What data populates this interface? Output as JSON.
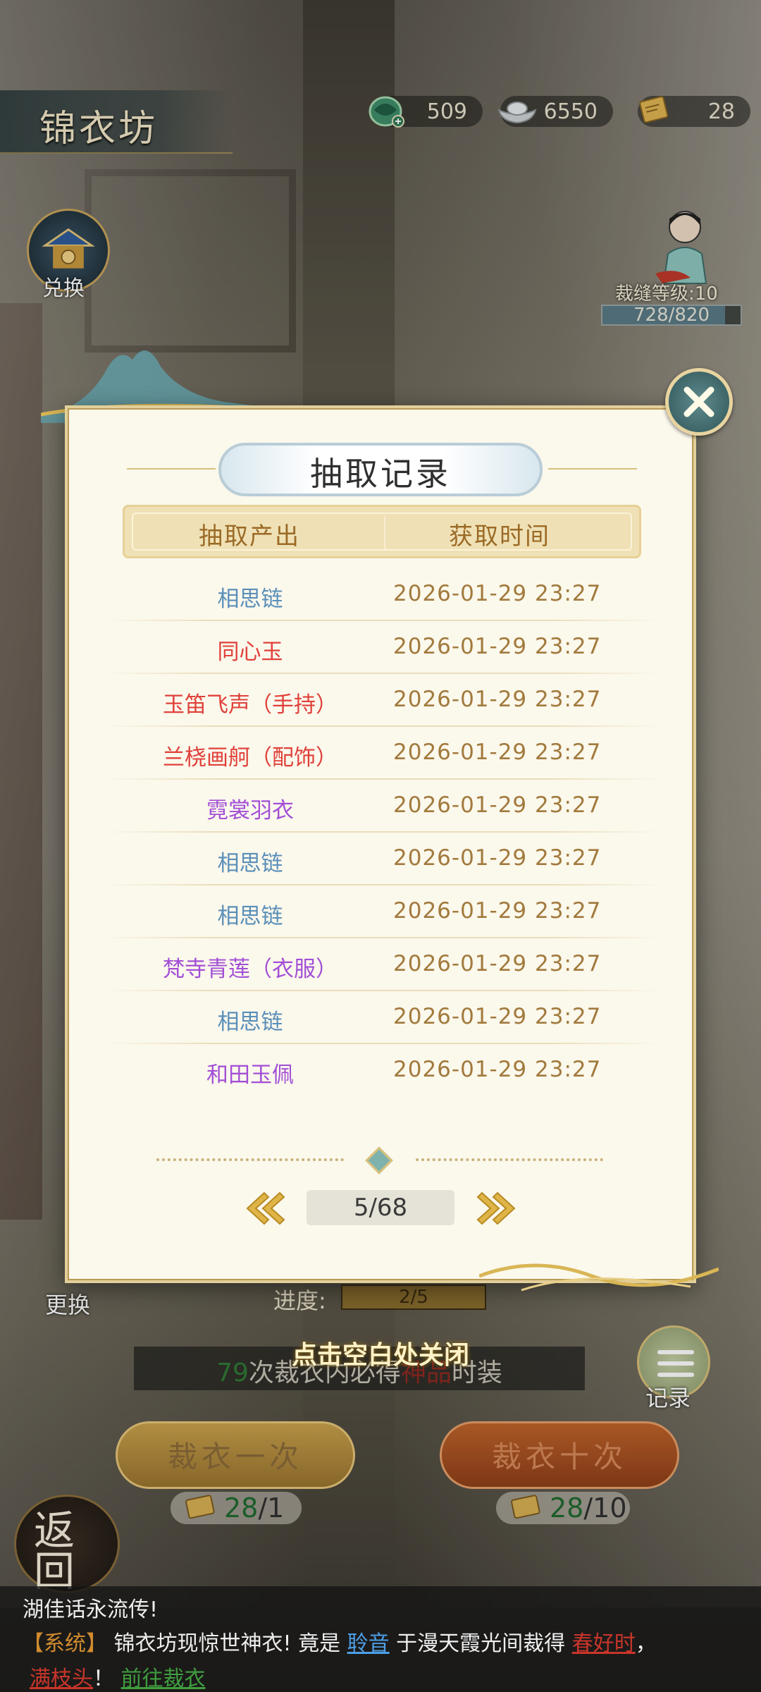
{
  "header": {
    "title": "锦衣坊",
    "resources": [
      {
        "icon": "jade-dragon-icon",
        "value": "509"
      },
      {
        "icon": "silver-ingot-icon",
        "value": "6550"
      },
      {
        "icon": "scroll-ticket-icon",
        "value": "28"
      }
    ]
  },
  "side": {
    "exchange_label": "兑换",
    "tailor_level": "裁缝等级:10",
    "tailor_exp": "728/820",
    "tailor_exp_fraction": 0.888
  },
  "modal": {
    "title": "抽取记录",
    "columns": [
      "抽取产出",
      "获取时间"
    ],
    "rows": [
      {
        "item": "相思链",
        "time": "2026-01-29   23:27",
        "color": "#5b8fb9"
      },
      {
        "item": "同心玉",
        "time": "2026-01-29   23:27",
        "color": "#e0413a"
      },
      {
        "item": "玉笛飞声（手持）",
        "time": "2026-01-29   23:27",
        "color": "#e0413a"
      },
      {
        "item": "兰桡画舸（配饰）",
        "time": "2026-01-29   23:27",
        "color": "#e0413a"
      },
      {
        "item": "霓裳羽衣",
        "time": "2026-01-29   23:27",
        "color": "#a24fd6"
      },
      {
        "item": "相思链",
        "time": "2026-01-29   23:27",
        "color": "#5b8fb9"
      },
      {
        "item": "相思链",
        "time": "2026-01-29   23:27",
        "color": "#5b8fb9"
      },
      {
        "item": "梵寺青莲（衣服）",
        "time": "2026-01-29   23:27",
        "color": "#a24fd6"
      },
      {
        "item": "相思链",
        "time": "2026-01-29   23:27",
        "color": "#5b8fb9"
      },
      {
        "item": "和田玉佩",
        "time": "2026-01-29   23:27",
        "color": "#a24fd6"
      }
    ],
    "page": "5/68",
    "close_hint": "点击空白处关闭"
  },
  "game": {
    "swap_label": "更换",
    "progress_label": "进度:",
    "progress_value": "2/5",
    "guarantee_count": "79",
    "guarantee_mid": "次裁衣内必得",
    "guarantee_quality": "神品",
    "guarantee_end": "时装",
    "record_label": "记录",
    "draw_one": "裁衣一次",
    "draw_ten": "裁衣十次",
    "cost_have": "28",
    "cost_one": "/1",
    "cost_ten": "/10",
    "back_label": "返回"
  },
  "chat": {
    "line1": "湖佳话永流传!",
    "tag": "【系统】",
    "text_a": " 锦衣坊现惊世神衣! 竟是 ",
    "user": "聆音",
    "text_b": " 于漫天霞光间裁得 ",
    "item": "春好时",
    "text_c": "，",
    "item2": "满枝头",
    "text_d": "！ ",
    "goto": "前往裁衣"
  }
}
